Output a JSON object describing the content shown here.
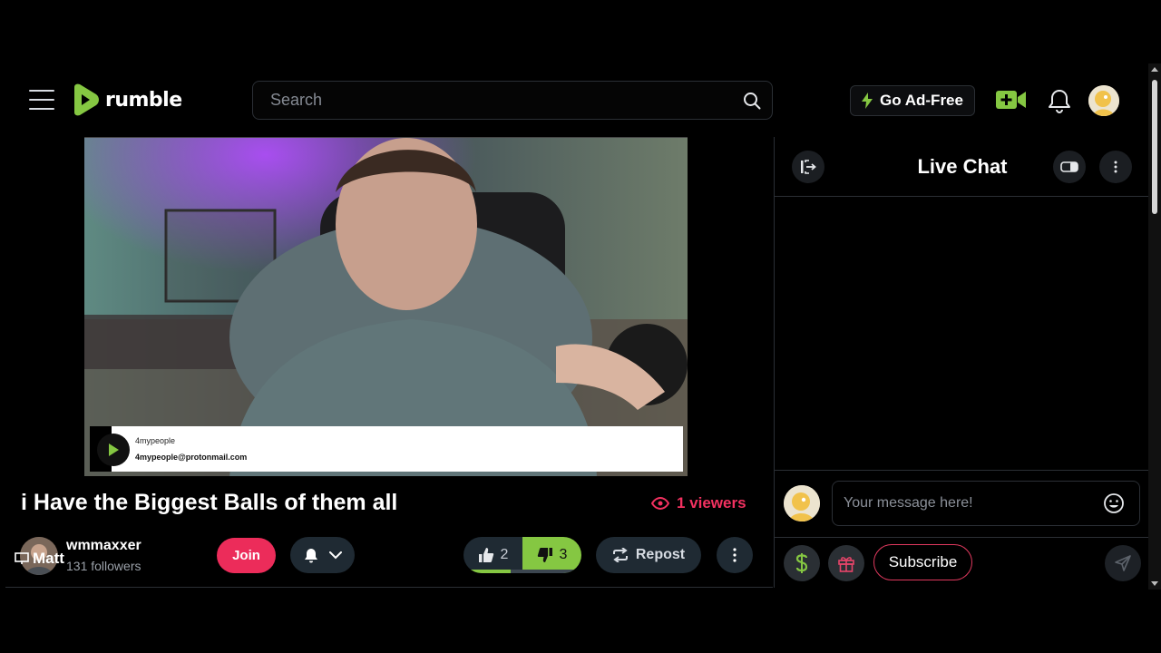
{
  "header": {
    "logo_text": "rumble",
    "search_placeholder": "Search",
    "go_ad_free_label": "Go Ad-Free"
  },
  "video": {
    "overlay_name": "4mypeople",
    "overlay_email": "4mypeople@protonmail.com",
    "title": "i Have the Biggest Balls of them all",
    "viewers": "1 viewers"
  },
  "channel": {
    "name": "wmmaxxer",
    "followers": "131 followers",
    "avatar_overlay_label": "Matt",
    "join_label": "Join"
  },
  "actions": {
    "likes": "2",
    "dislikes": "3",
    "repost_label": "Repost"
  },
  "chat": {
    "title": "Live Chat",
    "input_placeholder": "Your message here!",
    "subscribe_label": "Subscribe"
  },
  "colors": {
    "brand_green": "#85c742",
    "accent_pink": "#ec2c5a",
    "button_dark": "#1f2a33"
  }
}
